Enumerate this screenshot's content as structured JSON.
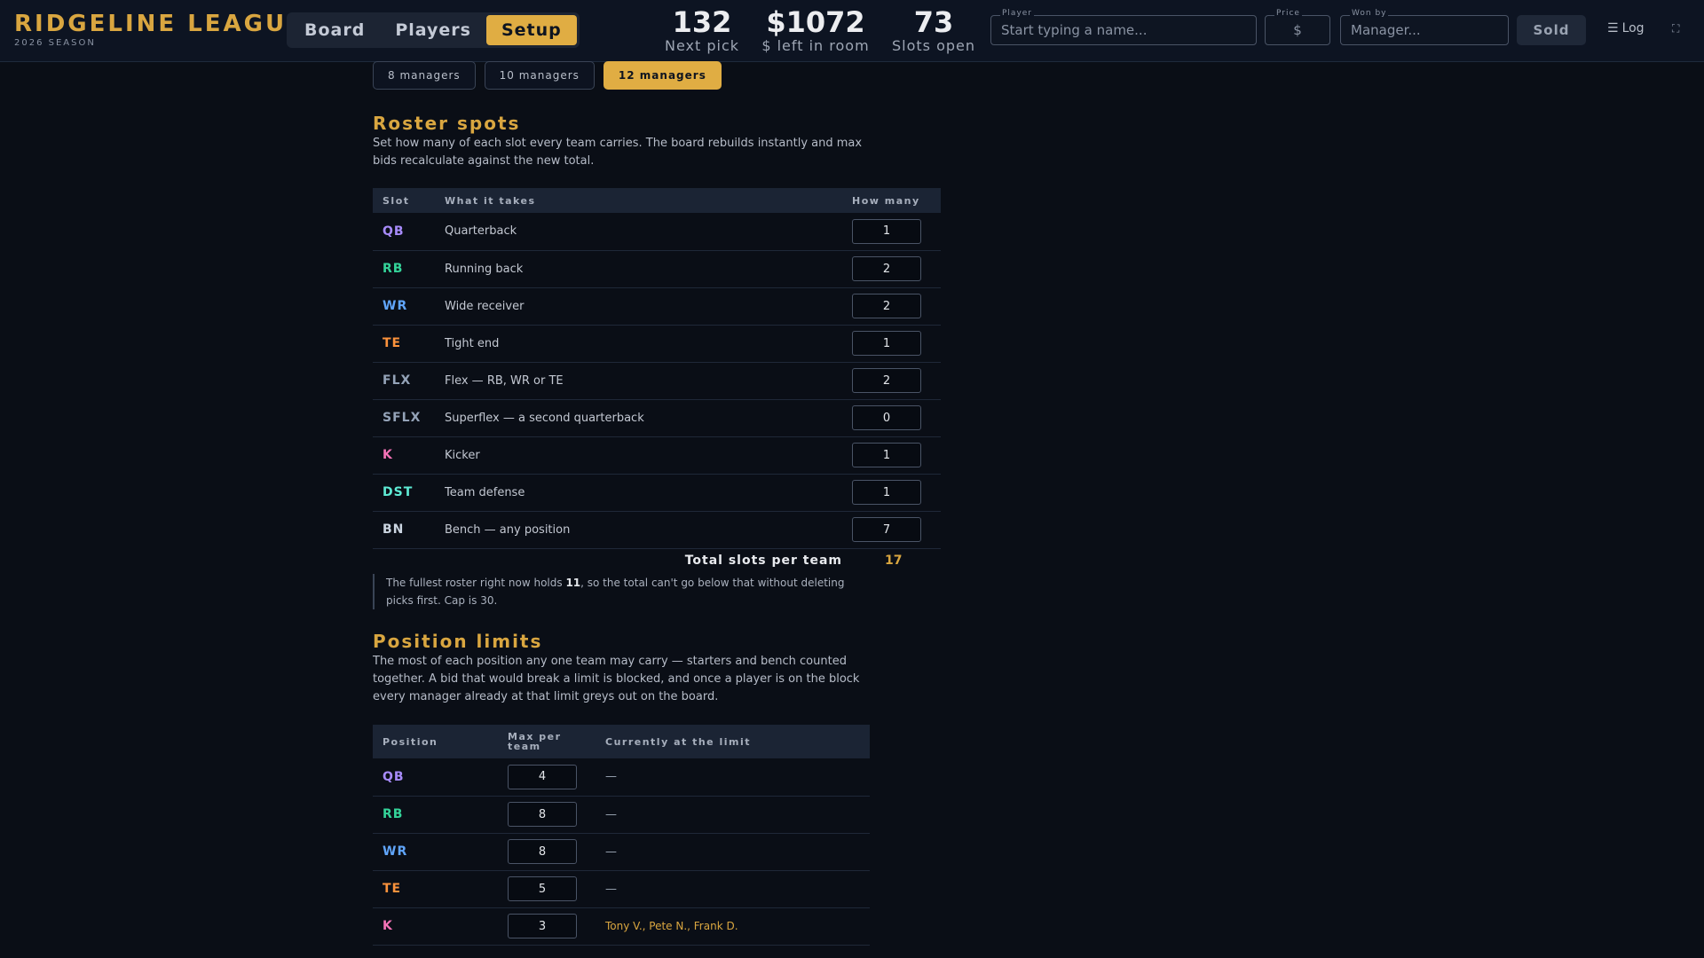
{
  "brand": {
    "title": "RIDGELINE LEAGUE",
    "subtitle": "2026 SEASON"
  },
  "nav": {
    "tabs": [
      {
        "label": "Board"
      },
      {
        "label": "Players"
      },
      {
        "label": "Setup"
      }
    ],
    "active": "Setup"
  },
  "stats": [
    {
      "value": "132",
      "label": "Next pick"
    },
    {
      "value": "$1072",
      "label": "$ left in room"
    },
    {
      "value": "73",
      "label": "Slots open"
    }
  ],
  "form": {
    "player": {
      "label": "Player",
      "placeholder": "Start typing a name..."
    },
    "price": {
      "label": "Price",
      "placeholder": "$"
    },
    "won_by": {
      "label": "Won by",
      "placeholder": "Manager..."
    },
    "sold_label": "Sold"
  },
  "log_label": "Log",
  "managers": {
    "options": [
      "8 managers",
      "10 managers",
      "12 managers"
    ],
    "selected": "12 managers"
  },
  "roster": {
    "title": "Roster spots",
    "description": "Set how many of each slot every team carries. The board rebuilds instantly and max bids recalculate against the new total.",
    "headers": {
      "slot": "Slot",
      "what": "What it takes",
      "count": "How many"
    },
    "rows": [
      {
        "slot": "QB",
        "what": "Quarterback",
        "count": "1",
        "color": "#a78bfa"
      },
      {
        "slot": "RB",
        "what": "Running back",
        "count": "2",
        "color": "#34d399"
      },
      {
        "slot": "WR",
        "what": "Wide receiver",
        "count": "2",
        "color": "#60a5fa"
      },
      {
        "slot": "TE",
        "what": "Tight end",
        "count": "1",
        "color": "#fb923c"
      },
      {
        "slot": "FLX",
        "what": "Flex — RB, WR or TE",
        "count": "2",
        "color": "#94a3b8"
      },
      {
        "slot": "SFLX",
        "what": "Superflex — a second quarterback",
        "count": "0",
        "color": "#94a3b8"
      },
      {
        "slot": "K",
        "what": "Kicker",
        "count": "1",
        "color": "#f472b6"
      },
      {
        "slot": "DST",
        "what": "Team defense",
        "count": "1",
        "color": "#5eead4"
      },
      {
        "slot": "BN",
        "what": "Bench — any position",
        "count": "7",
        "color": "#cbd5e1"
      }
    ],
    "total_label": "Total slots per team",
    "total_value": "17",
    "note_pre": "The fullest roster right now holds ",
    "note_bold": "11",
    "note_post": ", so the total can't go below that without deleting picks first. Cap is 30."
  },
  "limits": {
    "title": "Position limits",
    "description": "The most of each position any one team may carry — starters and bench counted together. A bid that would break a limit is blocked, and once a player is on the block every manager already at that limit greys out on the board.",
    "headers": {
      "position": "Position",
      "max": "Max per team",
      "current": "Currently at the limit"
    },
    "rows": [
      {
        "position": "QB",
        "max": "4",
        "current": "—",
        "color": "#a78bfa"
      },
      {
        "position": "RB",
        "max": "8",
        "current": "—",
        "color": "#34d399"
      },
      {
        "position": "WR",
        "max": "8",
        "current": "—",
        "color": "#60a5fa"
      },
      {
        "position": "TE",
        "max": "5",
        "current": "—",
        "color": "#fb923c"
      },
      {
        "position": "K",
        "max": "3",
        "current": "Tony V., Pete N., Frank D.",
        "color": "#f472b6"
      }
    ]
  }
}
